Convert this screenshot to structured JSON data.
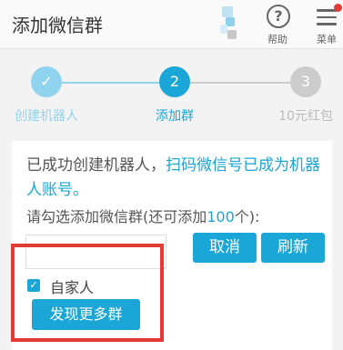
{
  "header": {
    "title": "添加微信群",
    "help_label": "帮助",
    "menu_label": "菜单"
  },
  "steps": [
    {
      "number": "✓",
      "label": "创建机器人",
      "state": "done"
    },
    {
      "number": "2",
      "label": "添加群",
      "state": "active"
    },
    {
      "number": "3",
      "label": "10元红包",
      "state": "pending"
    }
  ],
  "content": {
    "message_prefix": "已成功创建机器人，",
    "message_highlight": "扫码微信号已成为机器人账号。",
    "prompt_prefix": "请勾选添加微信群(还可添加",
    "prompt_count": "100",
    "prompt_suffix": "个):",
    "cancel_label": "取消",
    "refresh_label": "刷新",
    "group_name": "自家人",
    "group_checked": true,
    "more_groups_label": "发现更多群"
  },
  "colors": {
    "accent": "#1aa6d6",
    "step_done": "#8fd3ee",
    "step_pending": "#cccccc",
    "highlight": "#e53935"
  }
}
